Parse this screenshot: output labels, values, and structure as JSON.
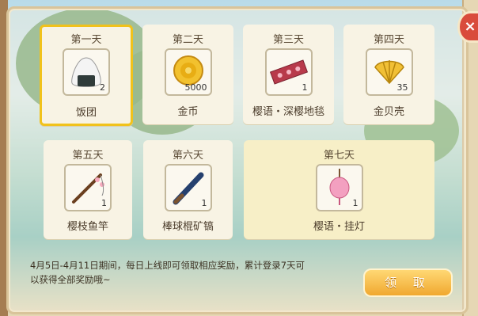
{
  "days": [
    {
      "day": "第一天",
      "name": "饭团",
      "qty": "2",
      "icon": "rice-ball-icon"
    },
    {
      "day": "第二天",
      "name": "金币",
      "qty": "5000",
      "icon": "gold-coin-icon"
    },
    {
      "day": "第三天",
      "name": "樱语・深樱地毯",
      "qty": "1",
      "icon": "carpet-icon"
    },
    {
      "day": "第四天",
      "name": "金贝壳",
      "qty": "35",
      "icon": "gold-shell-icon"
    },
    {
      "day": "第五天",
      "name": "樱枝鱼竿",
      "qty": "1",
      "icon": "fishing-rod-icon"
    },
    {
      "day": "第六天",
      "name": "棒球棍矿镐",
      "qty": "1",
      "icon": "baseball-bat-icon"
    },
    {
      "day": "第七天",
      "name": "樱语・挂灯",
      "qty": "1",
      "icon": "hanging-lamp-icon"
    }
  ],
  "description": "4月5日-4月11日期间，每日上线即可领取相应奖励，累计登录7天可以获得全部奖励哦~",
  "claim_label": "领 取",
  "close_label": "×",
  "colors": {
    "accent": "#f1c21b",
    "button": "#f0a830",
    "close": "#d94b3b"
  }
}
